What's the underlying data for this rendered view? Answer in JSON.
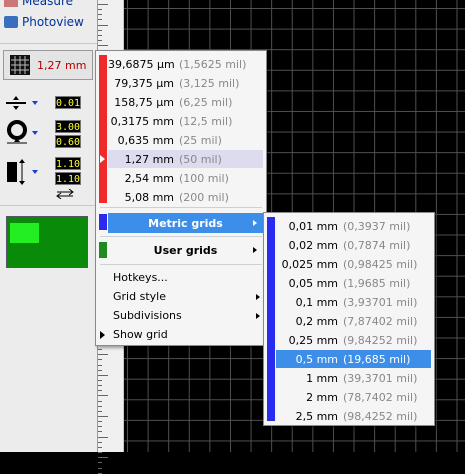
{
  "panel": {
    "measure_label": "Measure",
    "photoview_label": "Photoview",
    "grid_value": "1,27 mm",
    "track_width": "0.01",
    "via_outer": "3.00",
    "via_inner": "0.60",
    "pad_width": "1.10",
    "pad_height": "1.10"
  },
  "main_menu": {
    "metric_grid_items": [
      {
        "mm": "39,6875 µm",
        "mil": "(1,5625 mil)"
      },
      {
        "mm": "79,375 µm",
        "mil": "(3,125 mil)"
      },
      {
        "mm": "158,75 µm",
        "mil": "(6,25 mil)"
      },
      {
        "mm": "0,3175 mm",
        "mil": "(12,5 mil)"
      },
      {
        "mm": "0,635 mm",
        "mil": "(25 mil)"
      },
      {
        "mm": "1,27 mm",
        "mil": "(50 mil)"
      },
      {
        "mm": "2,54 mm",
        "mil": "(100 mil)"
      },
      {
        "mm": "5,08 mm",
        "mil": "(200 mil)"
      }
    ],
    "metric_grids_label": "Metric grids",
    "user_grids_label": "User grids",
    "hotkeys_label": "Hotkeys...",
    "grid_style_label": "Grid style",
    "subdivisions_label": "Subdivisions",
    "show_grid_label": "Show grid"
  },
  "sub_menu": {
    "items": [
      {
        "mm": "0,01 mm",
        "mil": "(0,3937 mil)"
      },
      {
        "mm": "0,02 mm",
        "mil": "(0,7874 mil)"
      },
      {
        "mm": "0,025 mm",
        "mil": "(0,98425 mil)"
      },
      {
        "mm": "0,05 mm",
        "mil": "(1,9685 mil)"
      },
      {
        "mm": "0,1 mm",
        "mil": "(3,93701 mil)"
      },
      {
        "mm": "0,2 mm",
        "mil": "(7,87402 mil)"
      },
      {
        "mm": "0,25 mm",
        "mil": "(9,84252 mil)"
      },
      {
        "mm": "0,5 mm",
        "mil": "(19,685 mil)"
      },
      {
        "mm": "1 mm",
        "mil": "(39,3701 mil)"
      },
      {
        "mm": "2 mm",
        "mil": "(78,7402 mil)"
      },
      {
        "mm": "2,5 mm",
        "mil": "(98,4252 mil)"
      }
    ]
  },
  "colors": {
    "strip_red": "#ee2a2a",
    "strip_blue": "#2b2bee",
    "strip_green": "#1f8a1f",
    "highlight": "#3d8ee8"
  }
}
